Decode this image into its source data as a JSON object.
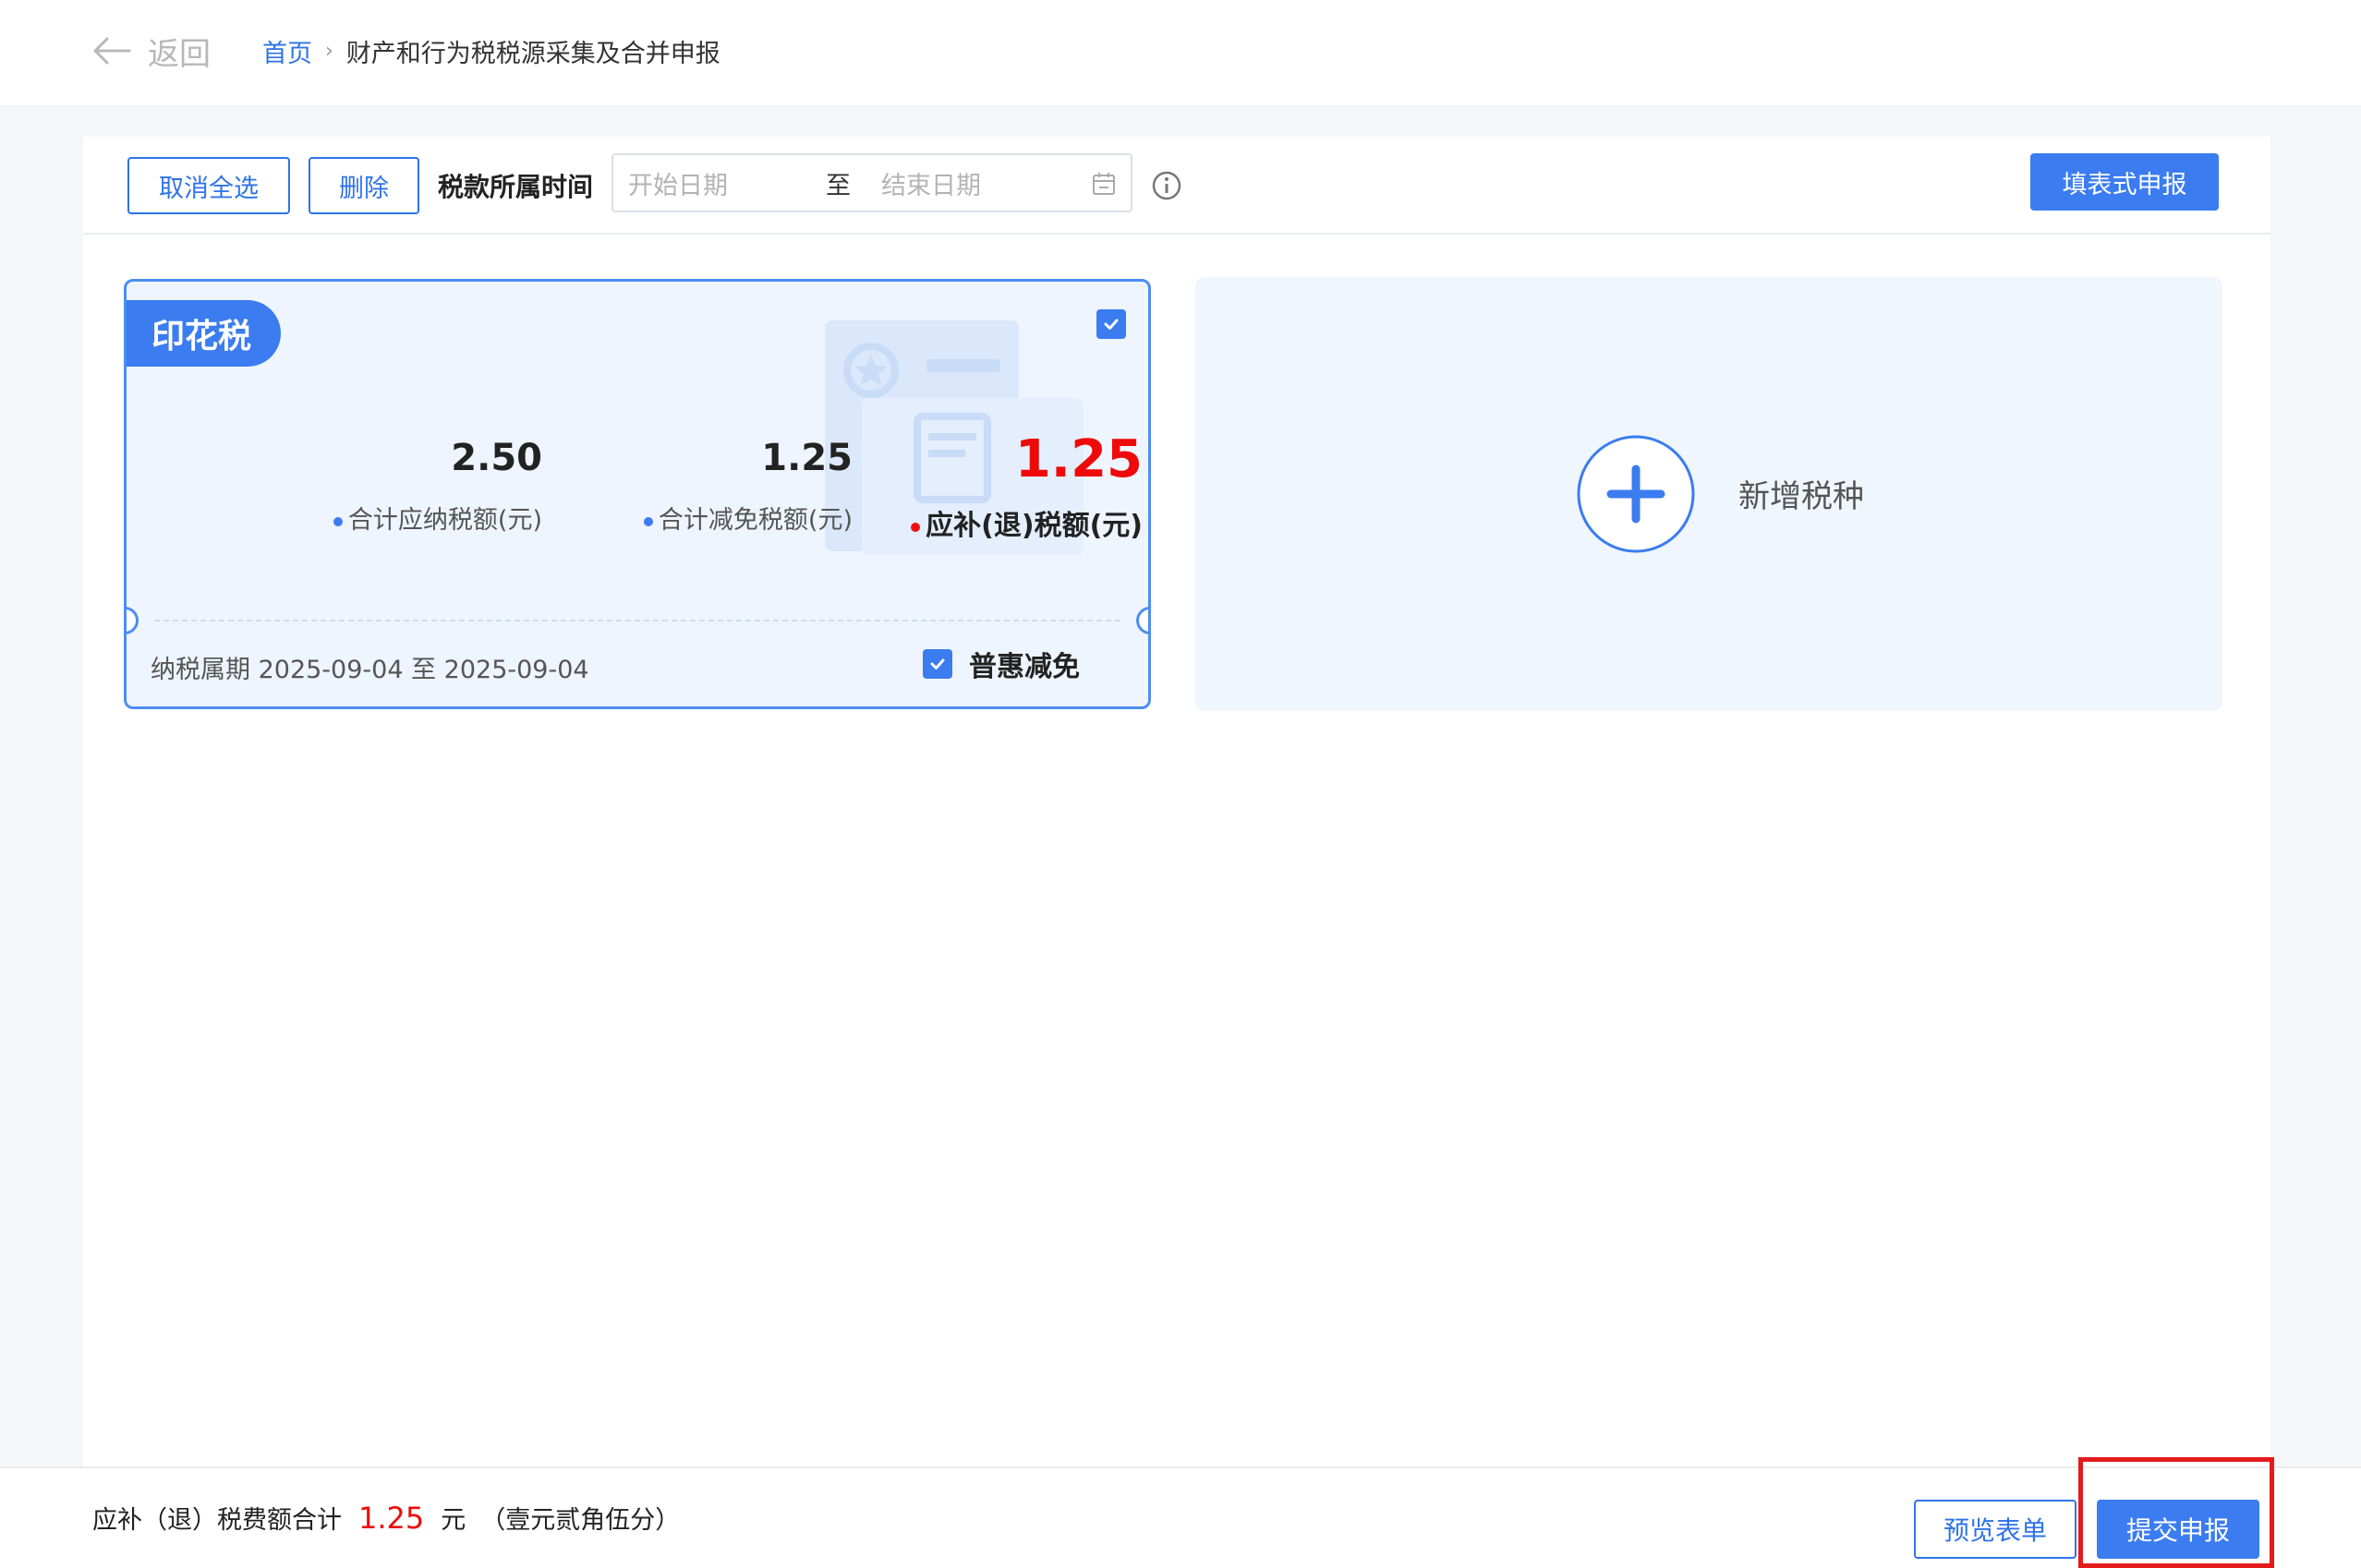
{
  "header": {
    "back_label": "返回",
    "breadcrumb": {
      "home": "首页",
      "current": "财产和行为税税源采集及合并申报"
    }
  },
  "toolbar": {
    "cancel_all_label": "取消全选",
    "delete_label": "删除",
    "period_label": "税款所属时间",
    "date_start_placeholder": "开始日期",
    "date_separator": "至",
    "date_end_placeholder": "结束日期",
    "form_declare_label": "填表式申报"
  },
  "tax_card": {
    "title": "印花税",
    "selected": true,
    "total_tax_value": "2.50",
    "total_tax_label": "合计应纳税额(元)",
    "reduction_value": "1.25",
    "reduction_label": "合计减免税额(元)",
    "payable_value": "1.25",
    "payable_label": "应补(退)税额(元)",
    "period": "纳税属期 2025-09-04 至 2025-09-04",
    "relief_checked": true,
    "relief_label": "普惠减免",
    "colors": {
      "accent": "#3b7cf0",
      "payable": "#ee0a0a"
    }
  },
  "add_card": {
    "label": "新增税种",
    "icon": "plus-circle-icon"
  },
  "footer": {
    "sum_label": "应补（退）税费额合计",
    "sum_amount": "1.25",
    "sum_unit": "元",
    "sum_in_words": "（壹元贰角伍分）",
    "preview_label": "预览表单",
    "submit_label": "提交申报"
  }
}
